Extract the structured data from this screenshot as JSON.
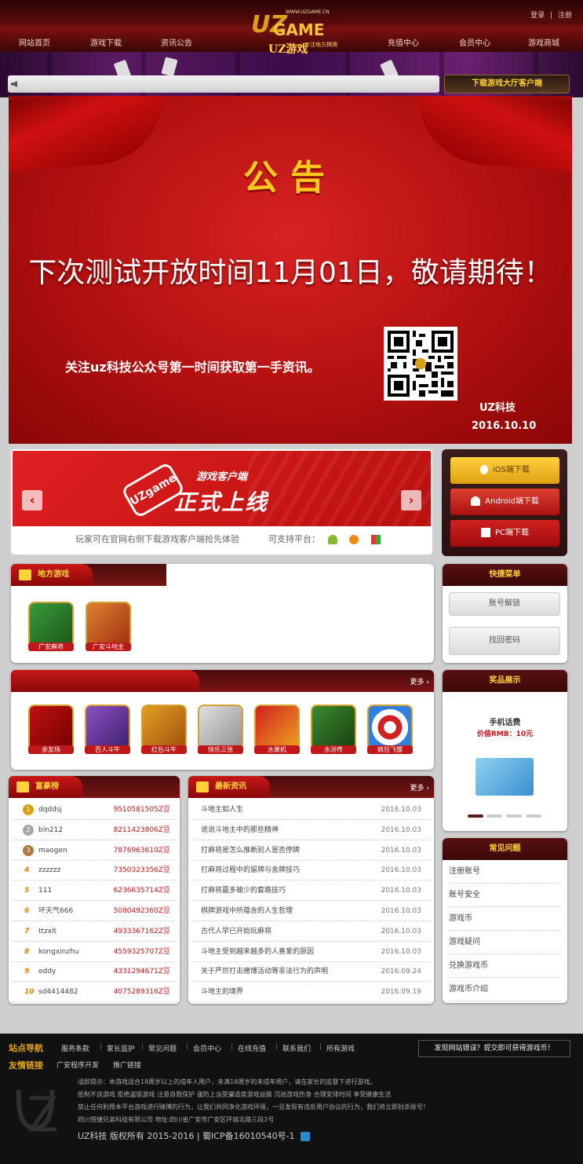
{
  "header": {
    "nav": [
      "网站首页",
      "游戏下载",
      "资讯公告",
      "充值中心",
      "会员中心",
      "游戏商城"
    ],
    "login": "登录",
    "divider": "|",
    "register": "注册",
    "logo": {
      "url": "WWW.UZGAME.CN",
      "brand": "UZ",
      "game": "GAME",
      "cn": "UZ游戏",
      "tagline": "专注地方棋牌"
    }
  },
  "download_banner": "下载游戏大厅客户端",
  "notice": {
    "title": "公告",
    "message": "下次测试开放时间11月01日，敬请期待！",
    "follow": "关注uz科技公众号第一时间获取第一手资讯。",
    "signature": "UZ科技",
    "date": "2016.10.10"
  },
  "promo": {
    "logo": "UZgame",
    "subtitle": "游戏客户端",
    "title": "正式上线",
    "desc": "玩家可在官网右侧下载游戏客户端抢先体验",
    "platforms": "可支持平台：",
    "prev": "‹",
    "next": "›"
  },
  "downloads": [
    {
      "label": "iOS端下载",
      "icon": "apple-icon"
    },
    {
      "label": "Android端下载",
      "icon": "android-icon"
    },
    {
      "label": "PC端下载",
      "icon": "windows-icon"
    }
  ],
  "local_games": {
    "title": "地方游戏",
    "games": [
      "广安麻将",
      "广安斗地主"
    ]
  },
  "all_games": {
    "more": "更多 ›",
    "games": [
      "亲友场",
      "百人斗牛",
      "红包斗牛",
      "快乐三张",
      "水果机",
      "水浒传",
      "疯狂飞镖"
    ]
  },
  "quick_menu": {
    "title": "快捷菜单",
    "items": [
      "账号解锁",
      "找回密码"
    ]
  },
  "prizes": {
    "title": "奖品展示",
    "name": "手机话费",
    "price": "价值RMB：10元"
  },
  "ranking": {
    "title": "富豪榜",
    "rows": [
      {
        "rank": "1",
        "name": "dqddsj",
        "value": "9510581505Z豆"
      },
      {
        "rank": "2",
        "name": "bin212",
        "value": "8211423806Z豆"
      },
      {
        "rank": "3",
        "name": "maogen",
        "value": "7876963610Z豆"
      },
      {
        "rank": "4",
        "name": "zzzzzz",
        "value": "7350323356Z豆"
      },
      {
        "rank": "5",
        "name": "111",
        "value": "6236635714Z豆"
      },
      {
        "rank": "6",
        "name": "坏天气666",
        "value": "5080492360Z豆"
      },
      {
        "rank": "7",
        "name": "ttzxlt",
        "value": "4933367162Z豆"
      },
      {
        "rank": "8",
        "name": "kongxinzhu",
        "value": "4559325707Z豆"
      },
      {
        "rank": "9",
        "name": "eddy",
        "value": "4331294671Z豆"
      },
      {
        "rank": "10",
        "name": "sd4414482",
        "value": "4075289316Z豆"
      }
    ]
  },
  "news": {
    "title": "最新资讯",
    "more": "更多 ›",
    "rows": [
      {
        "title": "斗地主如人生",
        "date": "2016.10.03"
      },
      {
        "title": "说说斗地主中的那些精神",
        "date": "2016.10.03"
      },
      {
        "title": "打麻将是怎么推断别人是否停牌",
        "date": "2016.10.03"
      },
      {
        "title": "打麻将过程中的留牌与舍牌技巧",
        "date": "2016.10.03"
      },
      {
        "title": "打麻将赢多输少的套路技巧",
        "date": "2016.10.03"
      },
      {
        "title": "棋牌游戏中所蕴含的人生哲理",
        "date": "2016.10.03"
      },
      {
        "title": "古代人早已开始玩麻将",
        "date": "2016.10.03"
      },
      {
        "title": "斗地主受到越来越多的人喜爱的原因",
        "date": "2016.10.03"
      },
      {
        "title": "关于严厉打击赌博活动等非法行为的声明",
        "date": "2016.09.24"
      },
      {
        "title": "斗地主的境界",
        "date": "2016.09.19"
      }
    ]
  },
  "faq": {
    "title": "常见问题",
    "items": [
      "注册账号",
      "账号安全",
      "游戏币",
      "游戏疑问",
      "兑换游戏币",
      "游戏币介绍"
    ]
  },
  "footer": {
    "site_nav": "站点导航",
    "links": [
      "服务条款",
      "家长监护",
      "常见问题",
      "会员中心",
      "在线充值",
      "联系我们",
      "所有游戏"
    ],
    "friend_links": "友情链接",
    "friends": [
      "广安程序开发",
      "推广链接"
    ],
    "report": "发现网站错误？提交即可获得游戏币！",
    "notice1": "适龄提示：本游戏适合18周岁以上的成年人用户，未满18周岁的未成年用户，请在家长的监督下进行游戏。",
    "notice2": "抵制不良游戏 拒绝盗版游戏 注意自我保护 谨防上当受骗适度游戏益脑 沉迷游戏伤身 合理安排时间 享受健康生活",
    "notice3": "禁止任何利用本平台游戏进行赌博的行为，让我们共同净化游戏环境，一旦发现有违反用户协议的行为，我们将立即封杀账号！",
    "company": "四川煜捷兄弟科技有限公司 地址:四川省广安市广安区环城北路三段2号",
    "copyright": "UZ科技 版权所有 2015-2016 | 蜀ICP备16010540号-1"
  }
}
